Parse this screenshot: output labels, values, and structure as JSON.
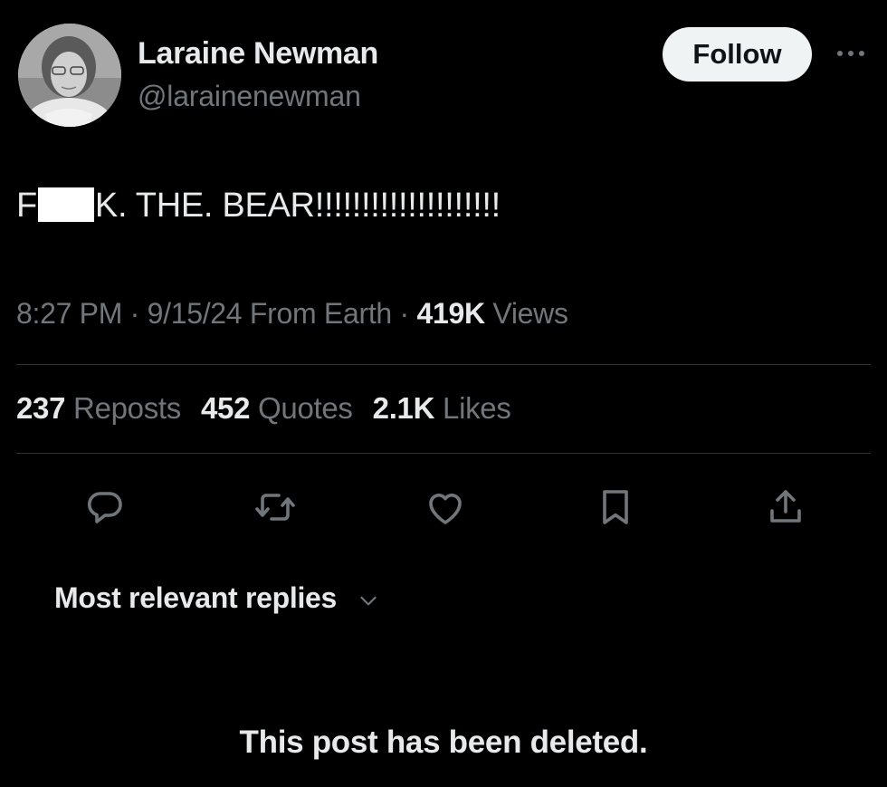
{
  "author": {
    "display_name": "Laraine Newman",
    "handle": "@larainenewman",
    "avatar_icon": "profile-photo-avatar"
  },
  "follow_button": {
    "label": "Follow"
  },
  "more_icon": "more-options-icon",
  "tweet": {
    "text_before": "F",
    "text_after": "K. THE. BEAR!!!!!!!!!!!!!!!!!!!!"
  },
  "meta": {
    "time": "8:27 PM",
    "sep1": " · ",
    "date": "9/15/24",
    "source": " From Earth",
    "sep2": " · ",
    "views_count": "419K",
    "views_label": " Views"
  },
  "stats": {
    "reposts_count": "237",
    "reposts_label": " Reposts",
    "quotes_count": "452",
    "quotes_label": " Quotes",
    "likes_count": "2.1K",
    "likes_label": " Likes"
  },
  "actions": [
    "reply-icon",
    "repost-icon",
    "like-icon",
    "bookmark-icon",
    "share-icon"
  ],
  "replies": {
    "sort_label": "Most relevant replies",
    "chevron_icon": "chevron-down-icon"
  },
  "deleted_notice": "This post has been deleted.",
  "colors": {
    "background": "#000000",
    "text_primary": "#e7e9ea",
    "text_secondary": "#71767b",
    "icon": "#71767b",
    "divider": "#2f3336",
    "follow_bg": "#eff3f4",
    "follow_text": "#0f1419"
  }
}
